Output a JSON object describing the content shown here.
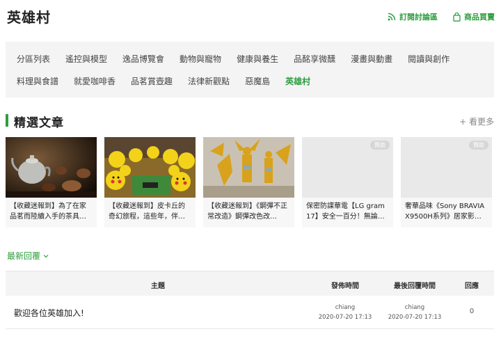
{
  "header": {
    "title": "英雄村",
    "subscribe_label": "訂閱討論區",
    "shop_label": "商品買賣"
  },
  "categories": {
    "row1": [
      "分區列表",
      "遙控與模型",
      "逸品博覽會",
      "動物與寵物",
      "健康與養生",
      "品酩享微醺",
      "漫畫與動畫",
      "閱讀與創作"
    ],
    "row2": [
      "料理與食譜",
      "就愛咖啡香",
      "品茗賞壺趣",
      "法律新觀點",
      "惡魔島",
      "英雄村"
    ],
    "active": "英雄村"
  },
  "featured": {
    "title": "精選文章",
    "more_label": "+ 看更多",
    "cards": [
      {
        "caption": "【收藏迷報到】為了在家品茗而陸續入手的茶具…",
        "sponsored": false,
        "image": "teapot-photo"
      },
      {
        "caption": "【收藏迷報到】皮卡丘的奇幻旅程，這些年，伴…",
        "sponsored": false,
        "image": "pikachu-photo"
      },
      {
        "caption": "【收藏迷報到】《鋼彈不正常改造》鋼彈改色改…",
        "sponsored": false,
        "image": "gundam-photo"
      },
      {
        "caption": "保密防諜華電【LG gram 17】安全一百分！無論…",
        "sponsored": true,
        "sponsor_label": "贊助",
        "image": "placeholder"
      },
      {
        "caption": "奢華品味《Sony BRAVIA X9500H系列》居家影…",
        "sponsored": true,
        "sponsor_label": "贊助",
        "image": "placeholder"
      }
    ]
  },
  "latest_label": "最新回覆",
  "table": {
    "headers": {
      "subject": "主題",
      "posted": "發佈時間",
      "last_reply": "最後回覆時間",
      "replies": "回應"
    },
    "rows": [
      {
        "subject": "歡迎各位英雄加入!",
        "posted_user": "chiang",
        "posted_time": "2020-07-20 17:13",
        "last_user": "chiang",
        "last_time": "2020-07-20 17:13",
        "replies": "0"
      }
    ]
  },
  "colors": {
    "accent": "#2e9e3e",
    "panel": "#f4f4f4"
  }
}
